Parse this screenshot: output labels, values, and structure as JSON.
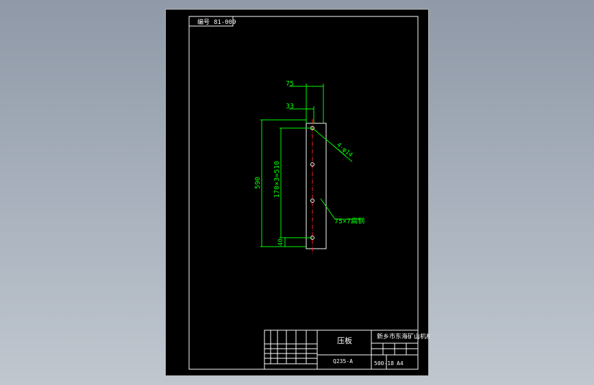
{
  "drawing": {
    "drawing_number": "81-009",
    "drawing_number_prefix": "编号",
    "dimensions": {
      "width_total": "75",
      "hole_offset": "33",
      "length_total": "590",
      "hole_pitch": "170×3=510",
      "end_offset": "40",
      "hole_callout": "4-φ14",
      "material_callout": "75×7扁钢"
    },
    "title_block": {
      "part_name": "压板",
      "company": "新乡市东海矿山机械厂",
      "material": "Q235-A",
      "project": "500-18",
      "sheet_type": "A4"
    }
  },
  "colors": {
    "frame": "#ffffff",
    "outline": "#ffffff",
    "dimension": "#00ff00",
    "centerline": "#ff2020",
    "background": "#000000"
  }
}
